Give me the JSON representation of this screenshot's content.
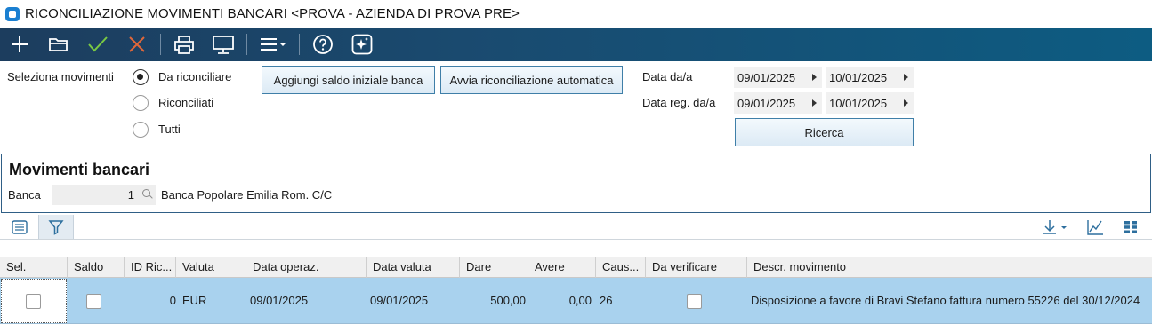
{
  "window": {
    "title": "RICONCILIAZIONE MOVIMENTI BANCARI <PROVA - AZIENDA DI PROVA PRE>"
  },
  "toolbar": {
    "buttons": [
      "add-icon",
      "open-folder-icon",
      "confirm-check-icon",
      "cancel-x-icon",
      "print-icon",
      "monitor-icon",
      "menu-icon",
      "help-icon",
      "ai-assistant-icon"
    ],
    "colors": {
      "bg_start": "#1c3d5e",
      "bg_end": "#0d5c82",
      "check": "#7ac943",
      "cancel": "#e0673a"
    }
  },
  "filters": {
    "select_label": "Seleziona movimenti",
    "radios": [
      {
        "label": "Da riconciliare",
        "checked": true
      },
      {
        "label": "Riconciliati",
        "checked": false
      },
      {
        "label": "Tutti",
        "checked": false
      }
    ],
    "add_balance_button": "Aggiungi saldo iniziale banca",
    "auto_reconcile_button": "Avvia riconciliazione automatica",
    "date_range_label": "Data da/a",
    "date_from": "09/01/2025",
    "date_to": "10/01/2025",
    "reg_date_range_label": "Data reg. da/a",
    "reg_date_from": "09/01/2025",
    "reg_date_to": "10/01/2025",
    "search_button": "Ricerca"
  },
  "panel": {
    "title": "Movimenti bancari",
    "bank_label": "Banca",
    "bank_code": "1",
    "bank_name": "Banca Popolare Emilia Rom. C/C"
  },
  "table": {
    "columns": [
      "Sel.",
      "Saldo",
      "ID Ric...",
      "Valuta",
      "Data operaz.",
      "Data valuta",
      "Dare",
      "Avere",
      "Caus...",
      "Da verificare",
      "Descr. movimento"
    ],
    "rows": [
      {
        "id_ric": "0",
        "valuta": "EUR",
        "data_operaz": "09/01/2025",
        "data_valuta": "09/01/2025",
        "dare": "500,00",
        "avere": "0,00",
        "causale": "26",
        "descrizione": "Disposizione a favore di Bravi Stefano fattura numero 55226 del 30/12/2024"
      }
    ],
    "selected_row_color": "#a9d2ee"
  }
}
